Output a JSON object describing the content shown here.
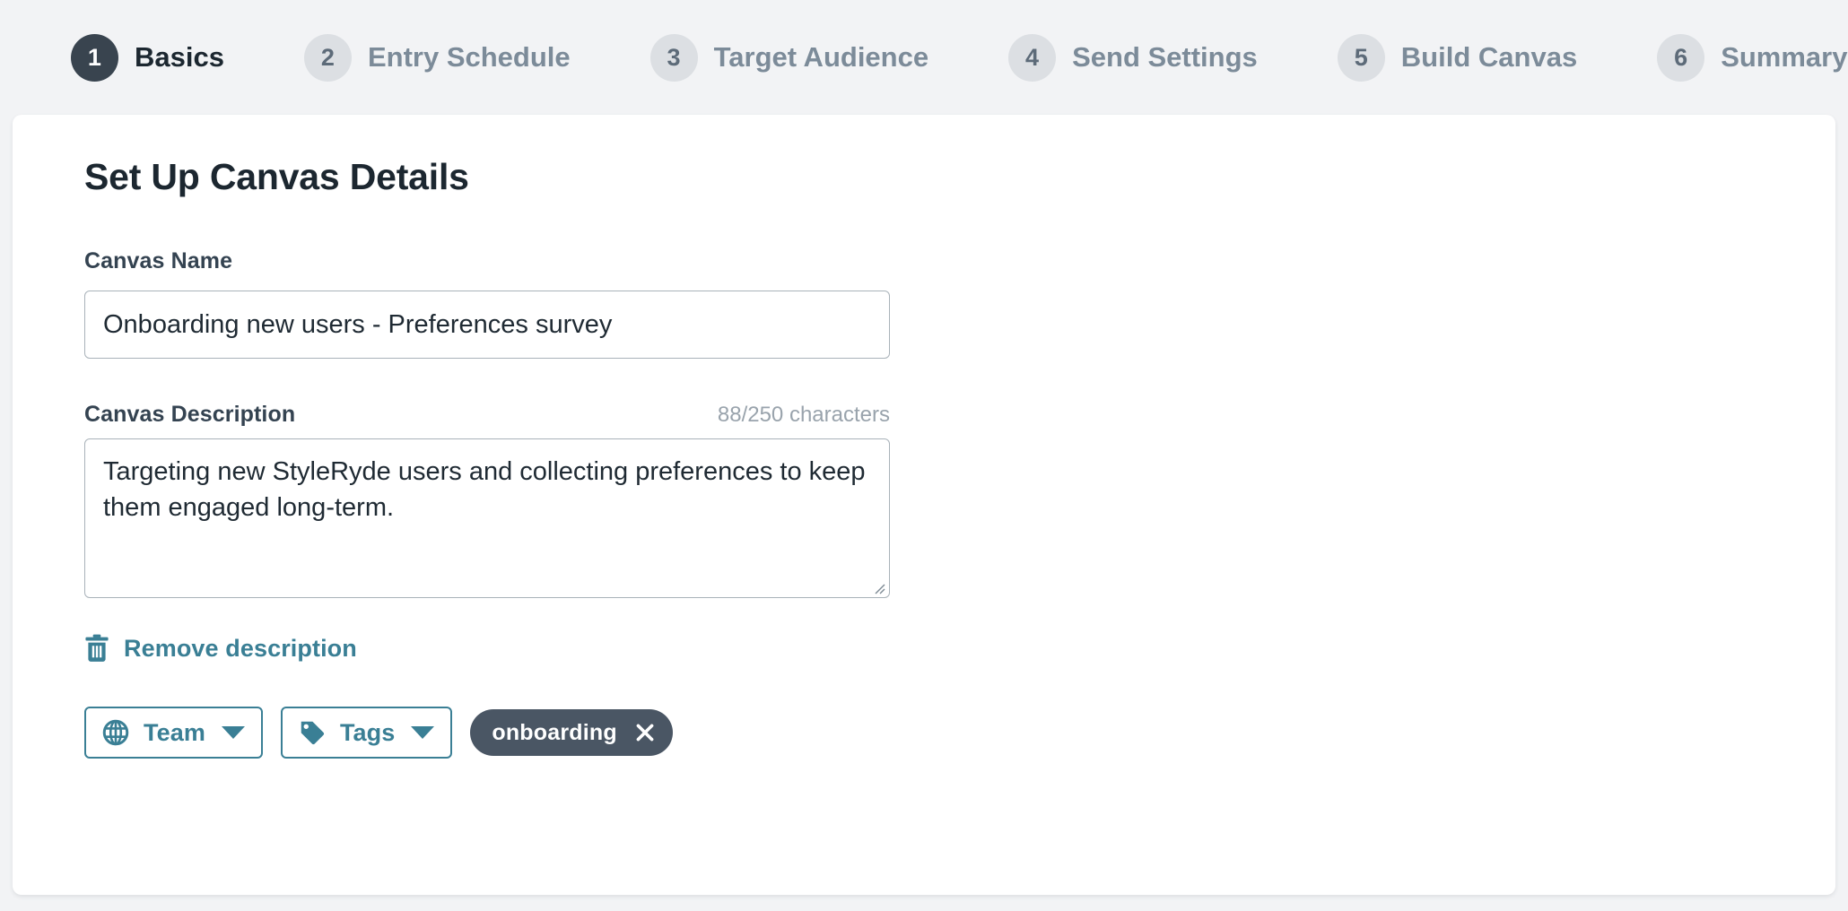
{
  "stepper": {
    "steps": [
      {
        "number": "1",
        "label": "Basics",
        "state": "active"
      },
      {
        "number": "2",
        "label": "Entry Schedule",
        "state": "inactive"
      },
      {
        "number": "3",
        "label": "Target Audience",
        "state": "inactive"
      },
      {
        "number": "4",
        "label": "Send Settings",
        "state": "inactive"
      },
      {
        "number": "5",
        "label": "Build Canvas",
        "state": "inactive"
      },
      {
        "number": "6",
        "label": "Summary",
        "state": "inactive"
      }
    ]
  },
  "main": {
    "title": "Set Up Canvas Details",
    "canvas_name": {
      "label": "Canvas Name",
      "value": "Onboarding new users - Preferences survey",
      "placeholder": ""
    },
    "canvas_description": {
      "label": "Canvas Description",
      "counter": "88/250 characters",
      "value": "Targeting new StyleRyde users and collecting preferences to keep them engaged long-term.",
      "placeholder": ""
    },
    "remove_description": {
      "label": "Remove description",
      "icon": "trash-icon"
    },
    "team_button": {
      "label": "Team",
      "icon": "globe-icon",
      "caret": "chevron-down-icon"
    },
    "tags_button": {
      "label": "Tags",
      "icon": "tag-icon",
      "caret": "chevron-down-icon"
    },
    "tag_chips": [
      {
        "label": "onboarding",
        "close_icon": "close-icon"
      }
    ]
  },
  "colors": {
    "page_background": "#f2f3f5",
    "card_background": "#ffffff",
    "accent_teal": "#3a7f95",
    "active_step": "#39444f",
    "inactive_step": "#dcdfe3",
    "chip_background": "#4a5664",
    "input_border": "#a9b2b9",
    "muted_text": "#99a3ac"
  }
}
